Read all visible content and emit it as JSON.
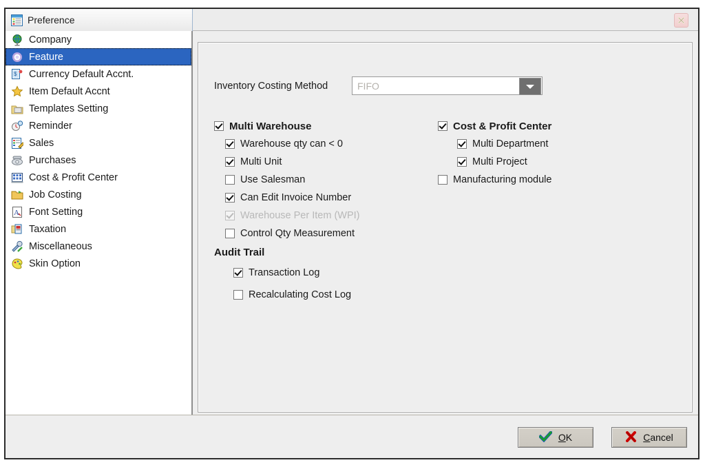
{
  "window": {
    "tab_label": "Preference",
    "tab_icon": "list-document-icon",
    "close_icon": "close-icon"
  },
  "sidebar": {
    "items": [
      {
        "label": "Company",
        "icon": "globe-icon",
        "selected": false
      },
      {
        "label": "Feature",
        "icon": "gear-icon",
        "selected": true
      },
      {
        "label": "Currency Default Accnt.",
        "icon": "currency-card-icon",
        "selected": false
      },
      {
        "label": "Item Default Accnt",
        "icon": "star-icon",
        "selected": false
      },
      {
        "label": "Templates Setting",
        "icon": "template-icon",
        "selected": false
      },
      {
        "label": "Reminder",
        "icon": "reminder-clock-icon",
        "selected": false
      },
      {
        "label": "Sales",
        "icon": "sales-form-icon",
        "selected": false
      },
      {
        "label": "Purchases",
        "icon": "phone-icon",
        "selected": false
      },
      {
        "label": "Cost & Profit Center",
        "icon": "building-icon",
        "selected": false
      },
      {
        "label": "Job Costing",
        "icon": "folder-job-icon",
        "selected": false
      },
      {
        "label": "Font Setting",
        "icon": "font-page-icon",
        "selected": false
      },
      {
        "label": "Taxation",
        "icon": "taxation-icon",
        "selected": false
      },
      {
        "label": "Miscellaneous",
        "icon": "tools-icon",
        "selected": false
      },
      {
        "label": "Skin Option",
        "icon": "skin-palette-icon",
        "selected": false
      }
    ]
  },
  "content": {
    "costing": {
      "label": "Inventory Costing Method",
      "value": "FIFO",
      "disabled": true,
      "arrow_icon": "chevron-down-icon"
    },
    "left_column": [
      {
        "label": "Multi Warehouse",
        "checked": true,
        "bold": true,
        "indent": 0,
        "disabled": false
      },
      {
        "label": "Warehouse qty can < 0",
        "checked": true,
        "bold": false,
        "indent": 1,
        "disabled": false
      },
      {
        "label": "Multi Unit",
        "checked": true,
        "bold": false,
        "indent": 1,
        "disabled": false
      },
      {
        "label": "Use Salesman",
        "checked": false,
        "bold": false,
        "indent": 1,
        "disabled": false
      },
      {
        "label": "Can Edit Invoice Number",
        "checked": true,
        "bold": false,
        "indent": 1,
        "disabled": false
      },
      {
        "label": "Warehouse Per Item (WPI)",
        "checked": true,
        "bold": false,
        "indent": 1,
        "disabled": true
      },
      {
        "label": "Control Qty Measurement",
        "checked": false,
        "bold": false,
        "indent": 1,
        "disabled": false
      }
    ],
    "audit_trail": {
      "heading": "Audit Trail",
      "items": [
        {
          "label": "Transaction Log",
          "checked": true,
          "disabled": false
        },
        {
          "label": "Recalculating Cost Log",
          "checked": false,
          "disabled": false
        }
      ]
    },
    "right_column": [
      {
        "label": "Cost & Profit Center",
        "checked": true,
        "bold": true,
        "indent": 0,
        "disabled": false
      },
      {
        "label": "Multi Department",
        "checked": true,
        "bold": false,
        "indent": 2,
        "disabled": false
      },
      {
        "label": "Multi Project",
        "checked": true,
        "bold": false,
        "indent": 2,
        "disabled": false
      },
      {
        "label": "Manufacturing module",
        "checked": false,
        "bold": false,
        "indent": 0,
        "disabled": false
      }
    ]
  },
  "footer": {
    "ok": {
      "label_pre": "",
      "label_mnemonic": "O",
      "label_post": "K",
      "icon": "check-icon"
    },
    "cancel": {
      "label_pre": "",
      "label_mnemonic": "C",
      "label_post": "ancel",
      "icon": "cross-icon"
    }
  },
  "colors": {
    "selection_blue": "#2b65c0",
    "panel_gray": "#eeeeee",
    "ok_green": "#1a9e2e",
    "cancel_red": "#cc0000",
    "disabled_text": "#b8b8b8"
  }
}
